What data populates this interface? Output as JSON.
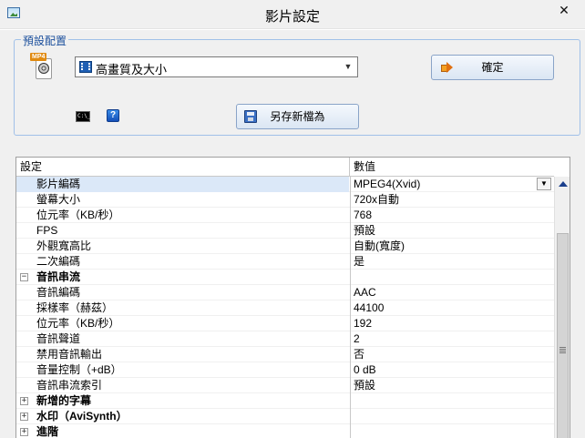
{
  "window": {
    "title": "影片設定",
    "close_label": "✕"
  },
  "preset": {
    "group_label": "預設配置",
    "file_icon_tag": "MP4",
    "selected": "高畫質及大小",
    "ok_label": "確定",
    "save_as_label": "另存新檔為",
    "cmd_icon_text": "C:\\_"
  },
  "grid": {
    "header": {
      "name": "設定",
      "value": "數值"
    },
    "rows": [
      {
        "name": "影片編碼",
        "value": "MPEG4(Xvid)",
        "type": "property",
        "selected": true
      },
      {
        "name": "螢幕大小",
        "value": "720x自動",
        "type": "property"
      },
      {
        "name": "位元率（KB/秒）",
        "value": "768",
        "type": "property"
      },
      {
        "name": "FPS",
        "value": "預設",
        "type": "property"
      },
      {
        "name": "外觀寬高比",
        "value": "自動(寬度)",
        "type": "property"
      },
      {
        "name": "二次編碼",
        "value": "是",
        "type": "property"
      },
      {
        "name": "音訊串流",
        "value": "",
        "type": "category",
        "expanded": true
      },
      {
        "name": "音訊編碼",
        "value": "AAC",
        "type": "property"
      },
      {
        "name": "採樣率（赫茲）",
        "value": "44100",
        "type": "property"
      },
      {
        "name": "位元率（KB/秒）",
        "value": "192",
        "type": "property"
      },
      {
        "name": "音訊聲道",
        "value": "2",
        "type": "property"
      },
      {
        "name": "禁用音訊輸出",
        "value": "否",
        "type": "property"
      },
      {
        "name": "音量控制（+dB）",
        "value": "0 dB",
        "type": "property"
      },
      {
        "name": "音訊串流索引",
        "value": "預設",
        "type": "property"
      },
      {
        "name": "新增的字幕",
        "value": "",
        "type": "category",
        "expanded": false
      },
      {
        "name": "水印（AviSynth）",
        "value": "",
        "type": "category",
        "expanded": false
      },
      {
        "name": "進階",
        "value": "",
        "type": "category",
        "expanded": false
      }
    ]
  },
  "colors": {
    "selection": "#dbe8f8",
    "group_label": "#1b4f9c",
    "button_border": "#8aa4c8"
  }
}
